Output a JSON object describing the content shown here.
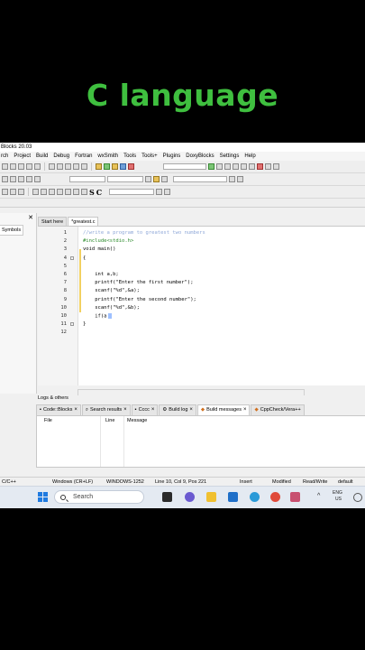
{
  "banner": {
    "title": "C language"
  },
  "app": {
    "title": "Blocks 20.03",
    "menu": [
      "rch",
      "Project",
      "Build",
      "Debug",
      "Fortran",
      "wxSmith",
      "Tools",
      "Tools+",
      "Plugins",
      "DoxyBlocks",
      "Settings",
      "Help"
    ],
    "management": {
      "tab_label": "Symbols",
      "close": "✕"
    },
    "editor_tabs": [
      "Start here",
      "*greatest.c"
    ],
    "code_lines": [
      {
        "n": "1",
        "text": "//write a program to greatest two numbers",
        "kind": "comment"
      },
      {
        "n": "2",
        "text": "#include<stdio.h>",
        "kind": "pre"
      },
      {
        "n": "3",
        "text": "void main()",
        "kind": "code"
      },
      {
        "n": "4",
        "text": "{",
        "kind": "code"
      },
      {
        "n": "5",
        "text": "",
        "kind": "code"
      },
      {
        "n": "6",
        "text": "    int a,b;",
        "kind": "code"
      },
      {
        "n": "7",
        "text": "    printf(\"Enter the first number\");",
        "kind": "code"
      },
      {
        "n": "8",
        "text": "    scanf(\"%d\",&a);",
        "kind": "code"
      },
      {
        "n": "9",
        "text": "    printf(\"Enter the second number\");",
        "kind": "code"
      },
      {
        "n": "10",
        "text": "    scanf(\"%d\",&b);",
        "kind": "code"
      },
      {
        "n": "10",
        "text": "    if(a",
        "kind": "code"
      },
      {
        "n": "11",
        "text": "}",
        "kind": "code"
      },
      {
        "n": "12",
        "text": "",
        "kind": "code"
      }
    ],
    "logs": {
      "title": "Logs & others",
      "tabs": [
        "Code::Blocks",
        "Search results",
        "Cccc",
        "Build log",
        "Build messages",
        "CppCheck/Vera++"
      ],
      "columns": [
        "File",
        "Line",
        "Message"
      ]
    },
    "statusbar": {
      "lang": "C/C++",
      "eol": "Windows (CR+LF)",
      "encoding": "WINDOWS-1252",
      "position": "Line 10, Col 9, Pos 221",
      "mode": "Insert",
      "modified": "Modified",
      "rw": "Read/Write",
      "profile": "default"
    }
  },
  "taskbar": {
    "search_placeholder": "Search",
    "lang_top": "ENG",
    "lang_bottom": "US",
    "chevron": "^"
  },
  "colors": {
    "banner_text": "#3fbf3f",
    "windows_blue": "#1f7ae0"
  }
}
